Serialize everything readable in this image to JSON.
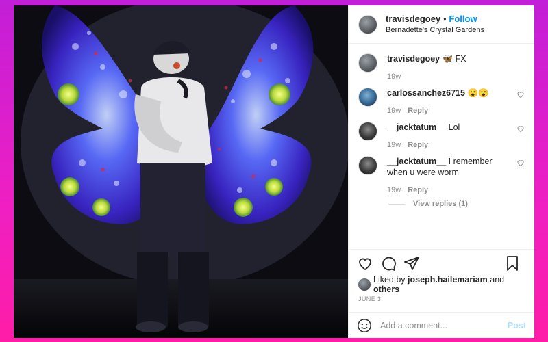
{
  "post": {
    "author": "travisdegoey",
    "follow_label": "Follow",
    "separator": "•",
    "location": "Bernadette's Crystal Gardens"
  },
  "comments": [
    {
      "user": "travisdegoey",
      "text": "🦋 FX",
      "time": "19w",
      "reply": "",
      "avatar": "avatar-travisdegoey"
    },
    {
      "user": "carlossanchez6715",
      "text": "😮😮",
      "time": "19w",
      "reply": "Reply",
      "avatar": "avatar-carlos"
    },
    {
      "user": "__jacktatum__",
      "text": "Lol",
      "time": "19w",
      "reply": "Reply",
      "avatar": "avatar-jack"
    },
    {
      "user": "__jacktatum__",
      "text": "I remember when u were worm",
      "time": "19w",
      "reply": "Reply",
      "avatar": "avatar-jack"
    }
  ],
  "view_replies": "View replies (1)",
  "actions": {
    "icons": [
      "heart-icon",
      "comment-icon",
      "share-icon",
      "bookmark-icon"
    ]
  },
  "likes": {
    "prefix": "Liked by",
    "user": "joseph.hailemariam",
    "middle": "and",
    "others": "others"
  },
  "date": "JUNE 3",
  "add_comment": {
    "placeholder": "Add a comment...",
    "post_label": "Post"
  },
  "colors": {
    "follow": "#0095f6",
    "post_disabled": "#b2dffc",
    "muted": "#8e8e8e",
    "text": "#262626"
  }
}
